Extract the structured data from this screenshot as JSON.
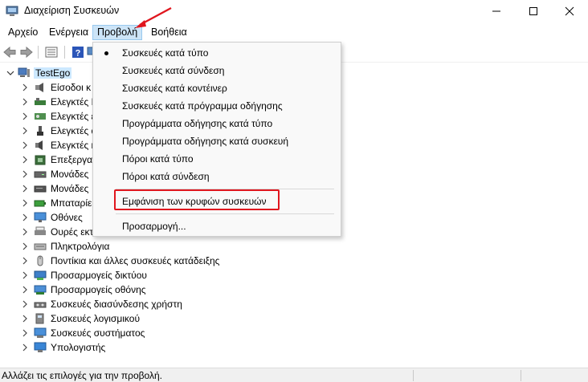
{
  "window": {
    "title": "Διαχείριση Συσκευών"
  },
  "menubar": {
    "items": [
      "Αρχείο",
      "Ενέργεια",
      "Προβολή",
      "Βοήθεια"
    ]
  },
  "dropdown": {
    "items": [
      "Συσκευές κατά τύπο",
      "Συσκευές κατά σύνδεση",
      "Συσκευές κατά κοντέινερ",
      "Συσκευές κατά πρόγραμμα οδήγησης",
      "Προγράμματα οδήγησης κατά τύπο",
      "Προγράμματα οδήγησης κατά συσκευή",
      "Πόροι κατά τύπο",
      "Πόροι κατά σύνδεση"
    ],
    "show_hidden": "Εμφάνιση των κρυφών συσκευών",
    "customize": "Προσαρμογή..."
  },
  "tree": {
    "root": "TestEgo",
    "categories": [
      "Είσοδοι κ",
      "Ελεγκτές Ι",
      "Ελεγκτές ε",
      "Ελεγκτές α",
      "Ελεγκτές η",
      "Επεξεργασ",
      "Μονάδες",
      "Μονάδες",
      "Μπαταρίε",
      "Οθόνες",
      "Ουρές εκτ",
      "Πληκτρολόγια",
      "Ποντίκια και άλλες συσκευές κατάδειξης",
      "Προσαρμογείς δικτύου",
      "Προσαρμογείς οθόνης",
      "Συσκευές διασύνδεσης χρήστη",
      "Συσκευές λογισμικού",
      "Συσκευές συστήματος",
      "Υπολογιστής"
    ]
  },
  "status": {
    "text": "Αλλάζει τις επιλογές για την προβολή."
  },
  "colors": {
    "highlight": "#e0161e",
    "selection": "#cce8ff",
    "menu_active": "#cce4f7"
  }
}
